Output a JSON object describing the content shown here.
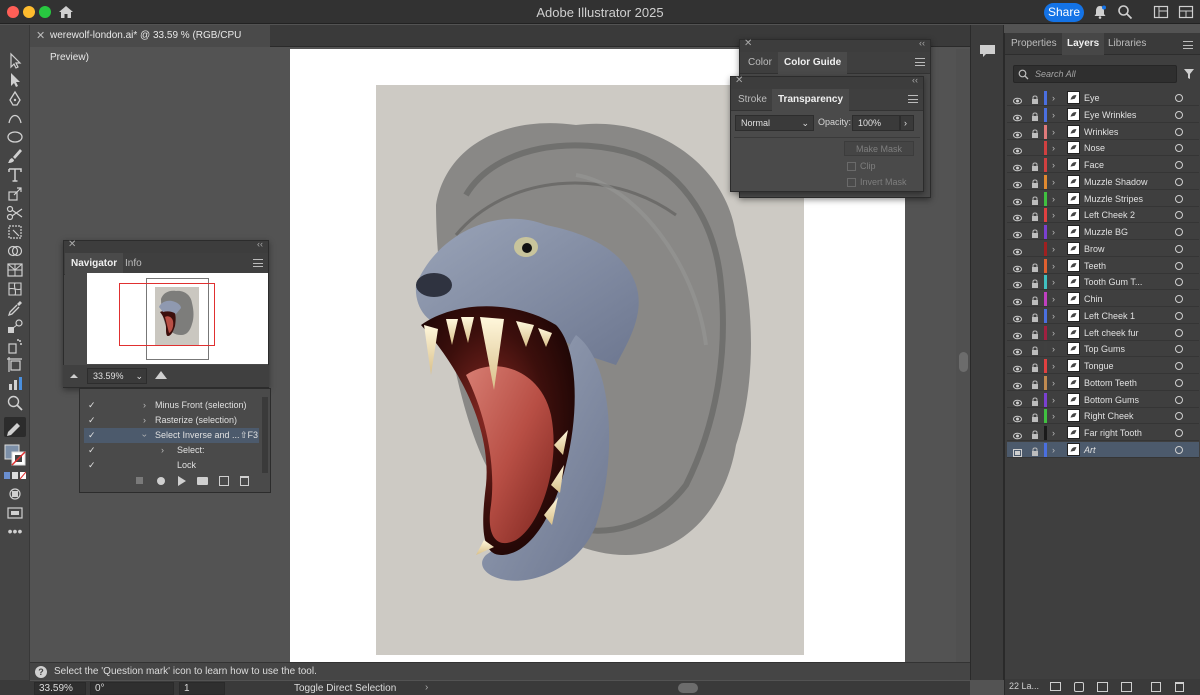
{
  "window": {
    "title": "Adobe Illustrator 2025",
    "share_label": "Share"
  },
  "document_tab": {
    "label": "werewolf-london.ai* @ 33.59 % (RGB/CPU Preview)"
  },
  "color_panel": {
    "tabs": [
      "Color",
      "Color Guide"
    ]
  },
  "transparency_panel": {
    "tabs": [
      "Stroke",
      "Transparency"
    ],
    "blend_mode": "Normal",
    "opacity_label": "Opacity:",
    "opacity_value": "100%",
    "make_mask": "Make Mask",
    "clip_label": "Clip",
    "invert_mask_label": "Invert Mask"
  },
  "navigator_panel": {
    "tabs": [
      "Navigator",
      "Info"
    ],
    "zoom_value": "33.59%"
  },
  "actions_panel": {
    "rows": [
      {
        "label": "Minus Front (selection)",
        "shortcut": ""
      },
      {
        "label": "Rasterize (selection)",
        "shortcut": ""
      },
      {
        "label": "Select Inverse and ...",
        "shortcut": "⇧F3"
      },
      {
        "label": "Select:",
        "shortcut": ""
      },
      {
        "label": "Lock",
        "shortcut": ""
      }
    ]
  },
  "layers_panel": {
    "tabs": [
      "Properties",
      "Layers",
      "Libraries"
    ],
    "search_placeholder": "Search All",
    "layers": [
      {
        "name": "Eye",
        "color": "#4a6fe0",
        "locked": true
      },
      {
        "name": "Eye Wrinkles",
        "color": "#4a6fe0",
        "locked": true
      },
      {
        "name": "Wrinkles",
        "color": "#e07a7a",
        "locked": true
      },
      {
        "name": "Nose",
        "color": "#d04040",
        "locked": false
      },
      {
        "name": "Face",
        "color": "#d04040",
        "locked": true
      },
      {
        "name": "Muzzle Shadow",
        "color": "#e08a30",
        "locked": true
      },
      {
        "name": "Muzzle Stripes",
        "color": "#40c040",
        "locked": true
      },
      {
        "name": "Left Cheek 2",
        "color": "#e04040",
        "locked": true
      },
      {
        "name": "Muzzle BG",
        "color": "#7a40d0",
        "locked": true
      },
      {
        "name": "Brow",
        "color": "#a02020",
        "locked": false
      },
      {
        "name": "Teeth",
        "color": "#e06030",
        "locked": true
      },
      {
        "name": "Tooth Gum T...",
        "color": "#40c0c0",
        "locked": true
      },
      {
        "name": "Chin",
        "color": "#c040c0",
        "locked": true
      },
      {
        "name": "Left Cheek 1",
        "color": "#4a6fe0",
        "locked": true
      },
      {
        "name": "Left cheek fur",
        "color": "#a02040",
        "locked": true
      },
      {
        "name": "Top Gums",
        "color": "#404040",
        "locked": true
      },
      {
        "name": "Tongue",
        "color": "#e04040",
        "locked": true
      },
      {
        "name": "Bottom Teeth",
        "color": "#c08a50",
        "locked": true
      },
      {
        "name": "Bottom Gums",
        "color": "#7a40d0",
        "locked": true
      },
      {
        "name": "Right Cheek",
        "color": "#40c040",
        "locked": true
      },
      {
        "name": "Far right Tooth",
        "color": "#1a1a1a",
        "locked": true
      },
      {
        "name": "Art",
        "color": "#4a6fe0",
        "locked": true
      }
    ],
    "footer_count": "22 La..."
  },
  "hint_bar": {
    "text": "Select the 'Question mark' icon to learn how to use the tool."
  },
  "status_bar": {
    "zoom": "33.59%",
    "rotation": "0°",
    "artboard": "1",
    "tool_label": "Toggle Direct Selection"
  }
}
